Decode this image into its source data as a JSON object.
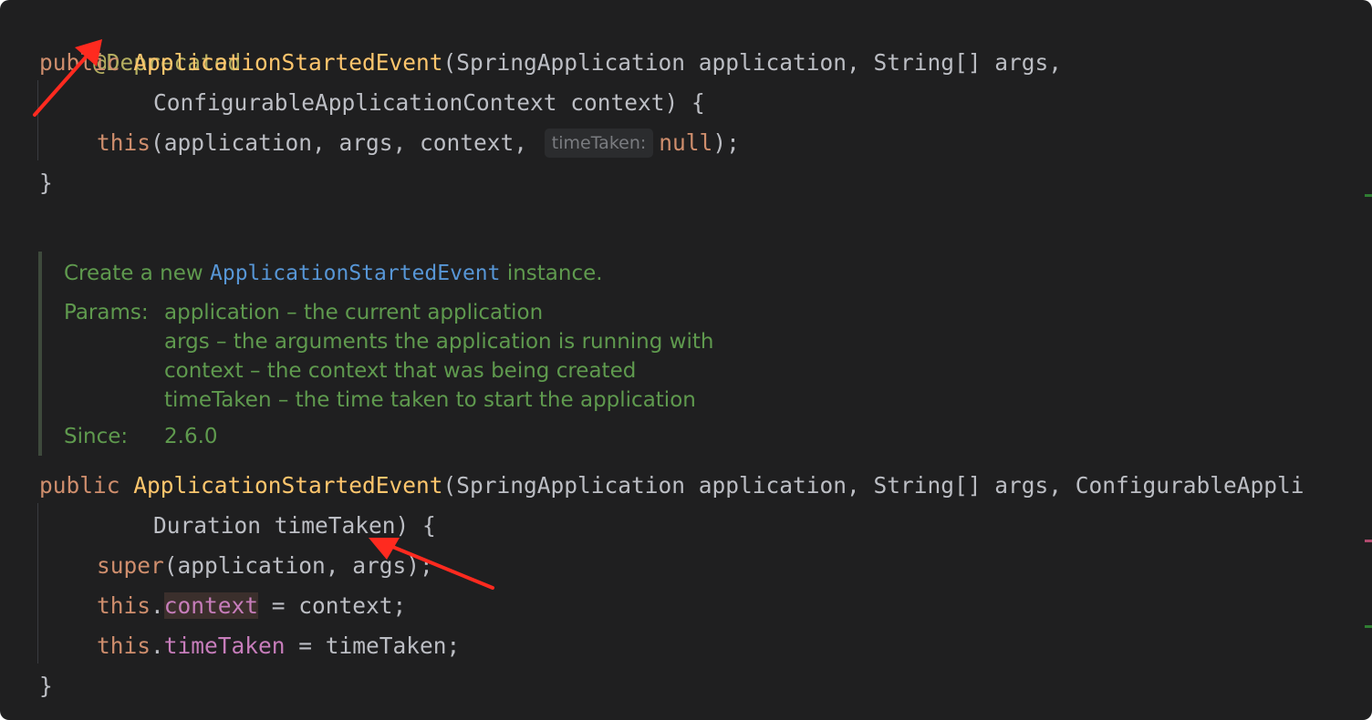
{
  "code": {
    "annotation": "@Deprecated",
    "ctor1": {
      "modifier": "public",
      "name": "ApplicationStartedEvent",
      "params_line1": "(SpringApplication application, String[] args,",
      "params_line2": "ConfigurableApplicationContext context) {",
      "body_this": "this",
      "body_args": "(application, args, context,",
      "hint": "timeTaken:",
      "body_null": "null",
      "body_end": ");",
      "close": "}"
    },
    "doc": {
      "summary_prefix": "Create a new",
      "summary_ref": "ApplicationStartedEvent",
      "summary_suffix": "instance.",
      "params_label": "Params:",
      "params": [
        "application – the current application",
        "args – the arguments the application is running with",
        "context – the context that was being created",
        "timeTaken – the time taken to start the application"
      ],
      "since_label": "Since:",
      "since_value": "2.6.0"
    },
    "ctor2": {
      "modifier": "public",
      "name": "ApplicationStartedEvent",
      "params_line1": "(SpringApplication application, String[] args, ConfigurableAppli",
      "params_line2": "Duration timeTaken) {",
      "super_kw": "super",
      "super_args": "(application, args);",
      "this1": "this",
      "field1": "context",
      "assign1": " = context;",
      "this2": "this",
      "field2": "timeTaken",
      "assign2": " = timeTaken;",
      "close": "}"
    }
  },
  "colors": {
    "background": "#1f1f20",
    "keyword": "#cf8e6d",
    "method": "#ffc66d",
    "annotation": "#b3ae60",
    "field": "#c77dbb",
    "doc_text": "#5f9a4e",
    "doc_ref": "#5796d6",
    "arrow": "#ff2a1f"
  }
}
